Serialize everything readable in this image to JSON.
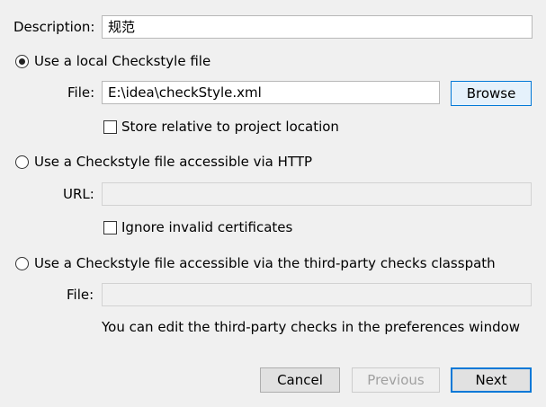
{
  "description": {
    "label": "Description:",
    "value": "规范"
  },
  "options": {
    "local": {
      "label": "Use a local Checkstyle file",
      "selected": true,
      "file_label": "File:",
      "file_value": "E:\\idea\\checkStyle.xml",
      "browse_label": "Browse",
      "store_relative_label": "Store relative to project location",
      "store_relative_checked": false
    },
    "http": {
      "label": "Use a Checkstyle file accessible via HTTP",
      "selected": false,
      "url_label": "URL:",
      "url_value": "",
      "ignore_certs_label": "Ignore invalid certificates",
      "ignore_certs_checked": false
    },
    "classpath": {
      "label": "Use a Checkstyle file accessible via the third-party checks classpath",
      "selected": false,
      "file_label": "File:",
      "file_value": "",
      "hint": "You can edit the third-party checks in the preferences window"
    }
  },
  "buttons": {
    "cancel": "Cancel",
    "previous": "Previous",
    "next": "Next"
  },
  "colors": {
    "background": "#f0f0f0",
    "accent": "#0078d7",
    "disabled_text": "#a0a0a0"
  }
}
